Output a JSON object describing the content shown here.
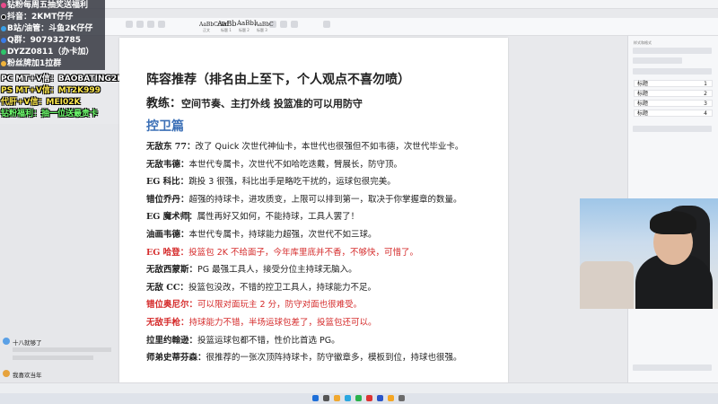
{
  "overlay": {
    "lines": [
      "钻粉每周五抽奖送福利",
      "抖音：2KMT仔仔",
      "B站/油管：斗鱼2K仔仔",
      "Q群：907932785",
      "DYZZ0811（办卡加）",
      "粉丝牌加1拉群"
    ],
    "promos": [
      "PC MT+V信：BAOBATING2K",
      "PS MT+V信：MT2K999",
      "代肝+V信：MEI02K",
      "钻粉福利：抽一位送最贵卡"
    ]
  },
  "ribbon": {
    "samples": [
      "AaBbCcDd",
      "AaBb",
      "AaBbI",
      "AaBbC"
    ],
    "subs": [
      "正文",
      "标题 1",
      "标题 2",
      "标题 3"
    ]
  },
  "doc": {
    "title": "阵容推荐（排名由上至下，个人观点不喜勿喷）",
    "coach_label": "教练：",
    "coach_text": "空间节奏、主打外线 投篮准的可以用防守",
    "section": "控卫篇",
    "items": [
      {
        "name": "无敌东 77：",
        "text": "改了 Quick 次世代神仙卡，本世代也很强但不如韦德，次世代毕业卡。",
        "red": false
      },
      {
        "name": "无敌韦德：",
        "text": "本世代专属卡，次世代不如哈吃迭戴，臂展长，防守顶。",
        "red": false
      },
      {
        "name": "EG 科比：",
        "text": "跳投 3 很强，科比出手是略吃干扰的，运球包很完美。",
        "red": false
      },
      {
        "name": "错位乔丹：",
        "text": "超强的持球卡，进攻质变，上限可以排到第一，取决于你掌握章的数量。",
        "red": false
      },
      {
        "name": "EG 魔术师：",
        "text": "属性再好又如何，不能持球，工具人罢了！",
        "red": false
      },
      {
        "name": "油画韦德：",
        "text": "本世代专属卡，持球能力超强，次世代不如三球。",
        "red": false
      },
      {
        "name": "EG 哈登：",
        "text": "投篮包 2K 不给面子，今年库里底并不香，不够快，可惜了。",
        "red": true
      },
      {
        "name": "无敌西蒙斯：",
        "text": "PG 最强工具人，接受分位主持球无脑入。",
        "red": false
      },
      {
        "name": "无敌 CC：",
        "text": "投篮包没改，不错的控卫工具人，持球能力不足。",
        "red": false
      },
      {
        "name": "错位奥尼尔：",
        "text": "可以限对面玩主 2 分，防守对面也很难受。",
        "red": true
      },
      {
        "name": "无敌手枪：",
        "text": "持球能力不错，半场运球包差了，投篮包还可以。",
        "red": true
      },
      {
        "name": "拉里约翰逊：",
        "text": "投篮运球包都不错，性价比首选 PG。",
        "red": false
      },
      {
        "name": "师弟史蒂芬森：",
        "text": "很推荐的一张次顶阵持球卡，防守徽章多，模板到位，持球也很强。",
        "red": false
      }
    ]
  },
  "panel": {
    "header": "样式和格式",
    "styles": [
      {
        "label": "标题",
        "num": "1"
      },
      {
        "label": "标题",
        "num": "2"
      },
      {
        "label": "标题",
        "num": "3"
      },
      {
        "label": "标题",
        "num": "4"
      }
    ]
  },
  "chat": {
    "messages": [
      {
        "user": "十八就够了",
        "faded": "",
        "color": "#5aa0e6"
      },
      {
        "user": "",
        "faded": "",
        "color": ""
      },
      {
        "user": "我喜欢当年",
        "faded": "",
        "color": "#e6a23c"
      }
    ]
  },
  "colors": {
    "heading_blue": "#3b6fb6",
    "red_text": "#d52b2b",
    "promo_white": "#ffffff",
    "promo_yellow": "#ffe94d",
    "promo_green": "#6fff6f"
  }
}
